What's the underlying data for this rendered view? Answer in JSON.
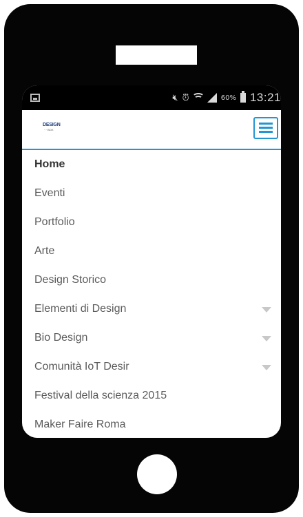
{
  "statusbar": {
    "battery_percent": "60%",
    "time": "13:21"
  },
  "header": {
    "logo_title": "DESIGN",
    "logo_subtitle": "··· BOX"
  },
  "menu": {
    "items": [
      {
        "label": "Home",
        "active": true,
        "has_submenu": false
      },
      {
        "label": "Eventi",
        "active": false,
        "has_submenu": false
      },
      {
        "label": "Portfolio",
        "active": false,
        "has_submenu": false
      },
      {
        "label": "Arte",
        "active": false,
        "has_submenu": false
      },
      {
        "label": "Design Storico",
        "active": false,
        "has_submenu": false
      },
      {
        "label": "Elementi di Design",
        "active": false,
        "has_submenu": true
      },
      {
        "label": "Bio Design",
        "active": false,
        "has_submenu": true
      },
      {
        "label": "Comunità IoT Desir",
        "active": false,
        "has_submenu": true
      },
      {
        "label": "Festival della scienza 2015",
        "active": false,
        "has_submenu": false
      },
      {
        "label": "Maker Faire Roma",
        "active": false,
        "has_submenu": false
      }
    ]
  },
  "colors": {
    "accent": "#2196d3",
    "phone_body": "#050505",
    "menu_text": "#5b5b5b",
    "caret": "#c8c8c8"
  }
}
